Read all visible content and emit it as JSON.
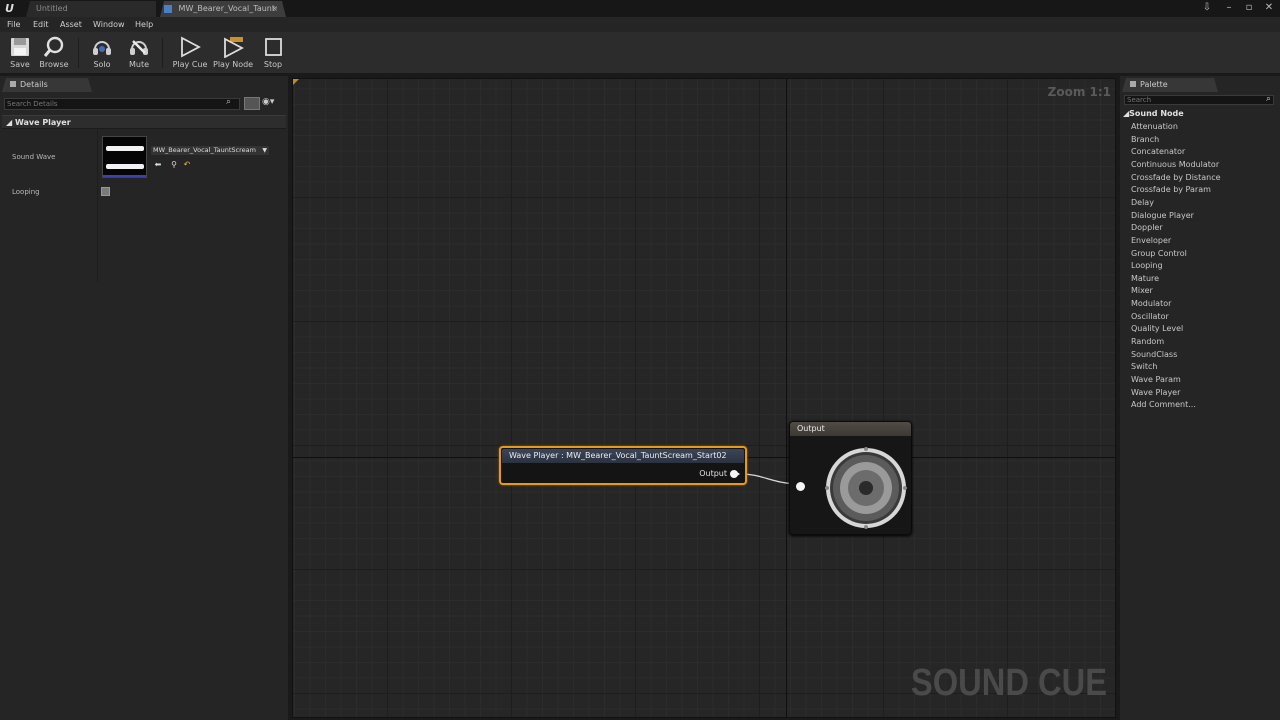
{
  "window": {
    "tabs": [
      {
        "label": "Untitled"
      },
      {
        "label": "MW_Bearer_Vocal_Taunt·"
      }
    ],
    "close_glyph": "×"
  },
  "menu": [
    "File",
    "Edit",
    "Asset",
    "Window",
    "Help"
  ],
  "toolbar": {
    "buttons": [
      {
        "label": "Save",
        "icon": "save-icon"
      },
      {
        "label": "Browse",
        "icon": "browse-icon"
      },
      {
        "label": "Solo",
        "icon": "solo-icon"
      },
      {
        "label": "Mute",
        "icon": "mute-icon"
      },
      {
        "label": "Play Cue",
        "icon": "play-cue-icon"
      },
      {
        "label": "Play Node",
        "icon": "play-node-icon"
      },
      {
        "label": "Stop",
        "icon": "stop-icon"
      }
    ]
  },
  "details": {
    "tab_label": "Details",
    "search_placeholder": "Search Details",
    "category": "Wave Player",
    "sound_wave_label": "Sound Wave",
    "sound_wave_value": "MW_Bearer_Vocal_TauntScream",
    "looping_label": "Looping",
    "looping_checked": false
  },
  "graph": {
    "zoom": "Zoom 1:1",
    "watermark": "SOUND CUE",
    "wave_node": {
      "title": "Wave Player : MW_Bearer_Vocal_TauntScream_Start02",
      "output_label": "Output"
    },
    "output_node": {
      "title": "Output"
    }
  },
  "palette": {
    "tab_label": "Palette",
    "search_placeholder": "Search",
    "category": "Sound Node",
    "items": [
      "Attenuation",
      "Branch",
      "Concatenator",
      "Continuous Modulator",
      "Crossfade by Distance",
      "Crossfade by Param",
      "Delay",
      "Dialogue Player",
      "Doppler",
      "Enveloper",
      "Group Control",
      "Looping",
      "Mature",
      "Mixer",
      "Modulator",
      "Oscillator",
      "Quality Level",
      "Random",
      "SoundClass",
      "Switch",
      "Wave Param",
      "Wave Player",
      "Add Comment..."
    ]
  },
  "colors": {
    "accent_orange": "#e59a1c",
    "wave_node_header": "#3a4658",
    "output_node_header": "#514c44"
  }
}
